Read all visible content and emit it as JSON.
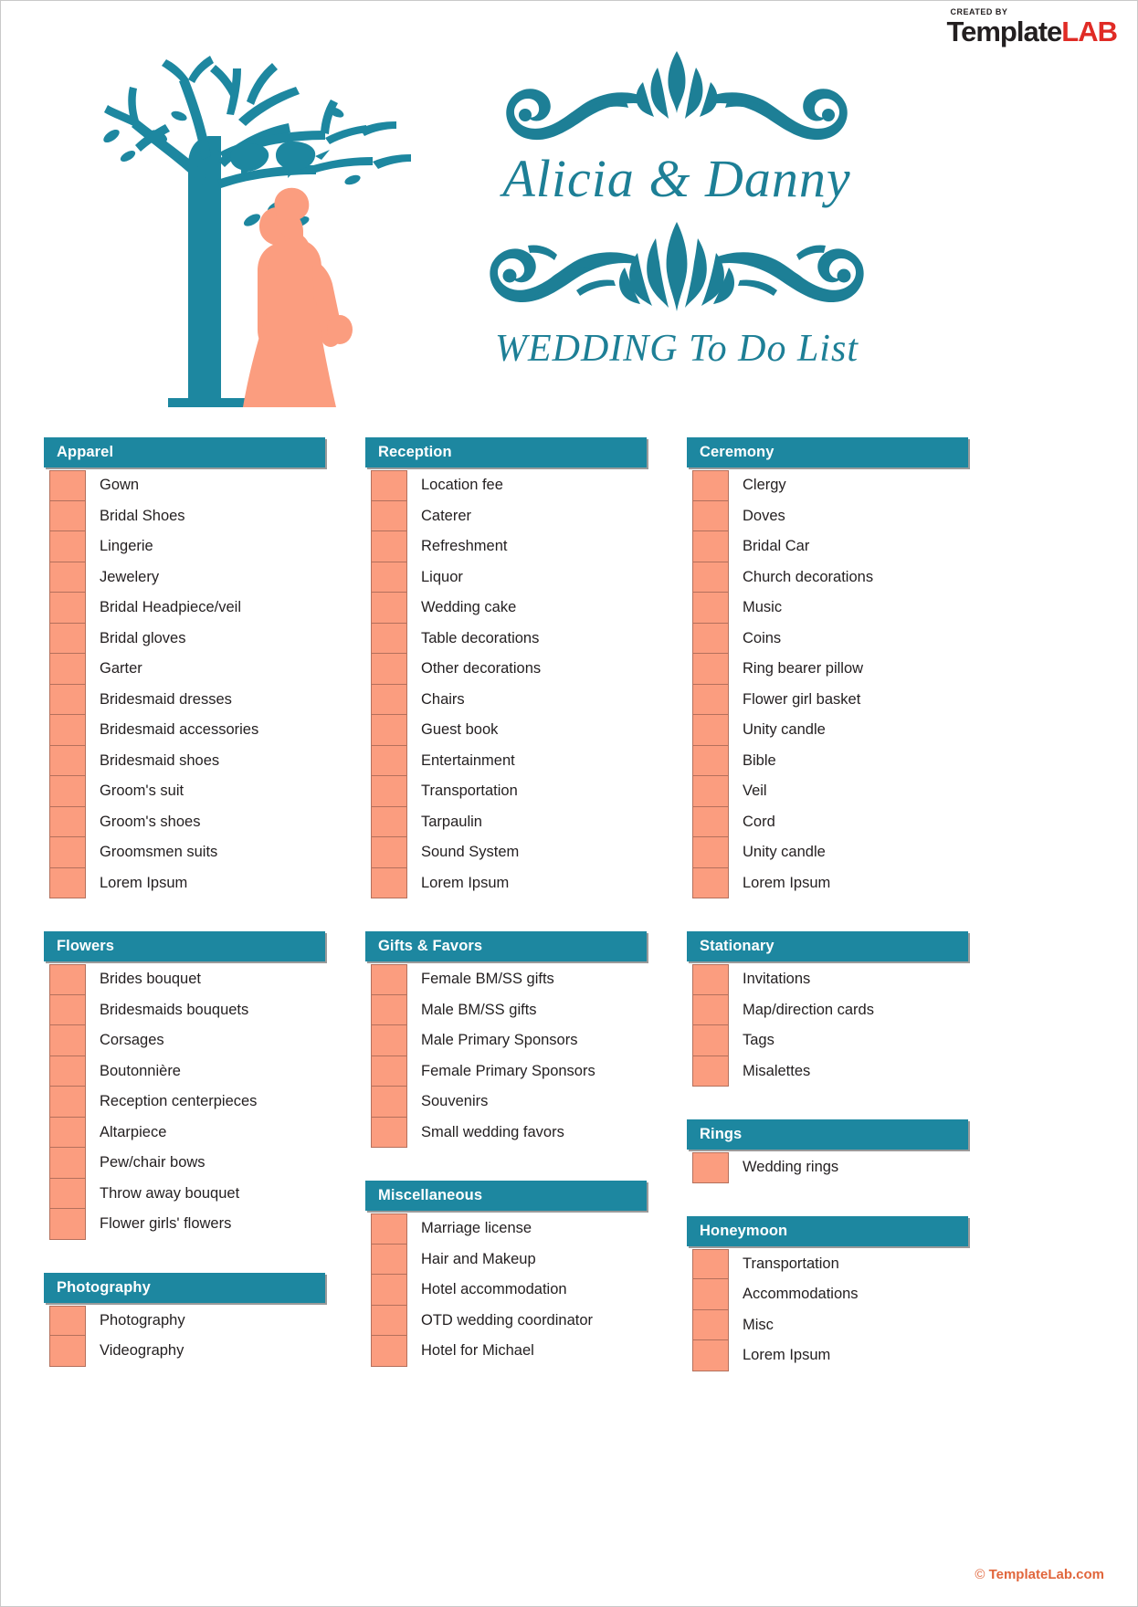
{
  "brand": {
    "created_by": "CREATED BY",
    "name_dark": "Template",
    "name_red": "LAB"
  },
  "header": {
    "couple_names": "Alicia & Danny",
    "subtitle": "WEDDING To Do List",
    "art_alt": "tree-with-birds-and-couple-silhouette"
  },
  "colors": {
    "teal": "#1d87a0",
    "teal_text": "#1d7f96",
    "salmon": "#fb9d7f",
    "salmon_border": "#b4705c",
    "brand_red": "#e02b25",
    "footer_orange": "#e1663c"
  },
  "columns": [
    {
      "sections": [
        {
          "title": "Apparel",
          "items": [
            "Gown",
            "Bridal Shoes",
            "Lingerie",
            "Jewelery",
            "Bridal Headpiece/veil",
            "Bridal gloves",
            "Garter",
            "Bridesmaid dresses",
            "Bridesmaid accessories",
            "Bridesmaid shoes",
            "Groom's suit",
            "Groom's shoes",
            "Groomsmen suits",
            "Lorem Ipsum"
          ]
        },
        {
          "title": "Flowers",
          "items": [
            "Brides bouquet",
            "Bridesmaids bouquets",
            "Corsages",
            "Boutonnière",
            "Reception centerpieces",
            "Altarpiece",
            "Pew/chair bows",
            "Throw away bouquet",
            "Flower girls' flowers"
          ]
        },
        {
          "title": "Photography",
          "items": [
            "Photography",
            "Videography"
          ]
        }
      ]
    },
    {
      "sections": [
        {
          "title": "Reception",
          "items": [
            "Location fee",
            "Caterer",
            "Refreshment",
            "Liquor",
            "Wedding cake",
            "Table decorations",
            "Other decorations",
            "Chairs",
            "Guest book",
            "Entertainment",
            "Transportation",
            "Tarpaulin",
            "Sound System",
            "Lorem Ipsum"
          ]
        },
        {
          "title": "Gifts & Favors",
          "items": [
            "Female BM/SS gifts",
            "Male BM/SS gifts",
            "Male Primary Sponsors",
            "Female Primary Sponsors",
            "Souvenirs",
            "Small wedding favors"
          ]
        },
        {
          "title": "Miscellaneous",
          "items": [
            "Marriage license",
            "Hair and Makeup",
            "Hotel accommodation",
            "OTD wedding coordinator",
            "Hotel for Michael"
          ]
        }
      ]
    },
    {
      "sections": [
        {
          "title": "Ceremony",
          "items": [
            "Clergy",
            "Doves",
            "Bridal Car",
            "Church decorations",
            "Music",
            "Coins",
            "Ring bearer pillow",
            "Flower girl basket",
            "Unity candle",
            "Bible",
            "Veil",
            "Cord",
            "Unity candle",
            "Lorem Ipsum"
          ]
        },
        {
          "title": "Stationary",
          "items": [
            "Invitations",
            "Map/direction cards",
            "Tags",
            "Misalettes"
          ]
        },
        {
          "title": "Rings",
          "items": [
            "Wedding rings"
          ]
        },
        {
          "title": "Honeymoon",
          "items": [
            "Transportation",
            "Accommodations",
            "Misc",
            "Lorem Ipsum"
          ]
        }
      ]
    }
  ],
  "footer": {
    "copyright": "©",
    "site": "TemplateLab.com"
  }
}
